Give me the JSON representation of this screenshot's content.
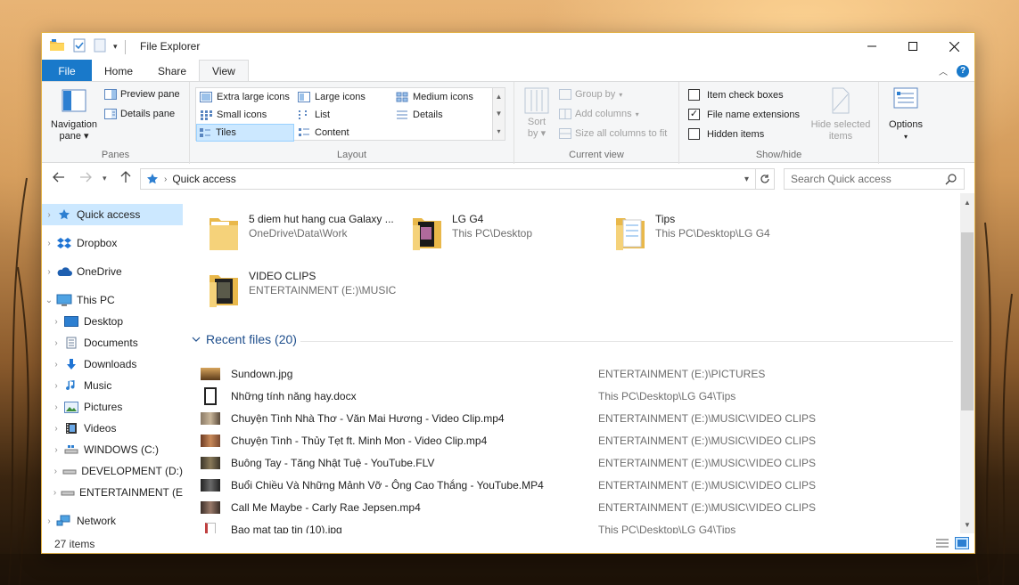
{
  "window": {
    "title": "File Explorer"
  },
  "tabs": [
    {
      "label": "File"
    },
    {
      "label": "Home"
    },
    {
      "label": "Share"
    },
    {
      "label": "View"
    }
  ],
  "ribbon": {
    "panes": {
      "navigation_pane": "Navigation",
      "navigation_pane_sub": "pane",
      "preview_pane": "Preview pane",
      "details_pane": "Details pane",
      "group_label": "Panes"
    },
    "layout": {
      "items": [
        "Extra large icons",
        "Large icons",
        "Medium icons",
        "Small icons",
        "List",
        "Details",
        "Tiles",
        "Content"
      ],
      "selected": "Tiles",
      "group_label": "Layout"
    },
    "current_view": {
      "sort_by": "Sort",
      "sort_by_sub": "by",
      "group_by": "Group by",
      "add_columns": "Add columns",
      "size_all_columns": "Size all columns to fit",
      "group_label": "Current view"
    },
    "show_hide": {
      "item_check_boxes": "Item check boxes",
      "item_check_boxes_checked": false,
      "file_name_extensions": "File name extensions",
      "file_name_extensions_checked": true,
      "hidden_items": "Hidden items",
      "hidden_items_checked": false,
      "hide_selected": "Hide selected",
      "hide_selected_sub": "items",
      "group_label": "Show/hide"
    },
    "options": {
      "label": "Options"
    }
  },
  "address": {
    "path": "Quick access",
    "search_placeholder": "Search Quick access"
  },
  "nav": [
    {
      "label": "Quick access",
      "icon": "star-icon",
      "selected": true
    },
    {
      "label": "Dropbox",
      "icon": "dropbox-icon"
    },
    {
      "label": "OneDrive",
      "icon": "cloud-icon"
    },
    {
      "label": "This PC",
      "icon": "computer-icon",
      "expanded": true
    },
    {
      "label": "Desktop",
      "icon": "desktop-icon"
    },
    {
      "label": "Documents",
      "icon": "documents-icon"
    },
    {
      "label": "Downloads",
      "icon": "download-icon"
    },
    {
      "label": "Music",
      "icon": "music-icon"
    },
    {
      "label": "Pictures",
      "icon": "pictures-icon"
    },
    {
      "label": "Videos",
      "icon": "videos-icon"
    },
    {
      "label": "WINDOWS (C:)",
      "icon": "drive-icon"
    },
    {
      "label": "DEVELOPMENT (D:)",
      "icon": "drive-icon"
    },
    {
      "label": "ENTERTAINMENT (E",
      "icon": "drive-icon"
    },
    {
      "label": "Network",
      "icon": "network-icon"
    }
  ],
  "frequent_folders": [
    {
      "name": "5 diem hut hang cua Galaxy ...",
      "path": "OneDrive\\Data\\Work"
    },
    {
      "name": "LG G4",
      "path": "This PC\\Desktop"
    },
    {
      "name": "Tips",
      "path": "This PC\\Desktop\\LG G4"
    },
    {
      "name": "VIDEO CLIPS",
      "path": "ENTERTAINMENT (E:)\\MUSIC"
    }
  ],
  "recent": {
    "header": "Recent files (20)",
    "files": [
      {
        "name": "Sundown.jpg",
        "path": "ENTERTAINMENT (E:)\\PICTURES",
        "color": "#8a5a2a"
      },
      {
        "name": "Những tính năng hay.docx",
        "path": "This PC\\Desktop\\LG G4\\Tips",
        "color": "#333333"
      },
      {
        "name": "Chuyện Tình Nhà Thơ - Văn Mai Hương - Video Clip.mp4",
        "path": "ENTERTAINMENT (E:)\\MUSIC\\VIDEO CLIPS",
        "color": "#6b5a48"
      },
      {
        "name": "Chuyện Tình - Thủy Tẹt ft. Minh Mon - Video Clip.mp4",
        "path": "ENTERTAINMENT (E:)\\MUSIC\\VIDEO CLIPS",
        "color": "#7a4a30"
      },
      {
        "name": "Buông Tay - Tăng Nhật Tuệ - YouTube.FLV",
        "path": "ENTERTAINMENT (E:)\\MUSIC\\VIDEO CLIPS",
        "color": "#4a4030"
      },
      {
        "name": "Buổi Chiều Và Những Mảnh Vỡ - Ông Cao Thắng - YouTube.MP4",
        "path": "ENTERTAINMENT (E:)\\MUSIC\\VIDEO CLIPS",
        "color": "#3a3a3a"
      },
      {
        "name": "Call Me Maybe - Carly Rae Jepsen.mp4",
        "path": "ENTERTAINMENT (E:)\\MUSIC\\VIDEO CLIPS",
        "color": "#5a4a40"
      },
      {
        "name": "Bao mat tap tin (10).jpg",
        "path": "This PC\\Desktop\\LG G4\\Tips",
        "color": "#c04040"
      }
    ]
  },
  "status": {
    "items": "27 items"
  },
  "colors": {
    "accent": "#1979ca",
    "selection": "#cce8ff",
    "window_border": "#e3b34a"
  }
}
